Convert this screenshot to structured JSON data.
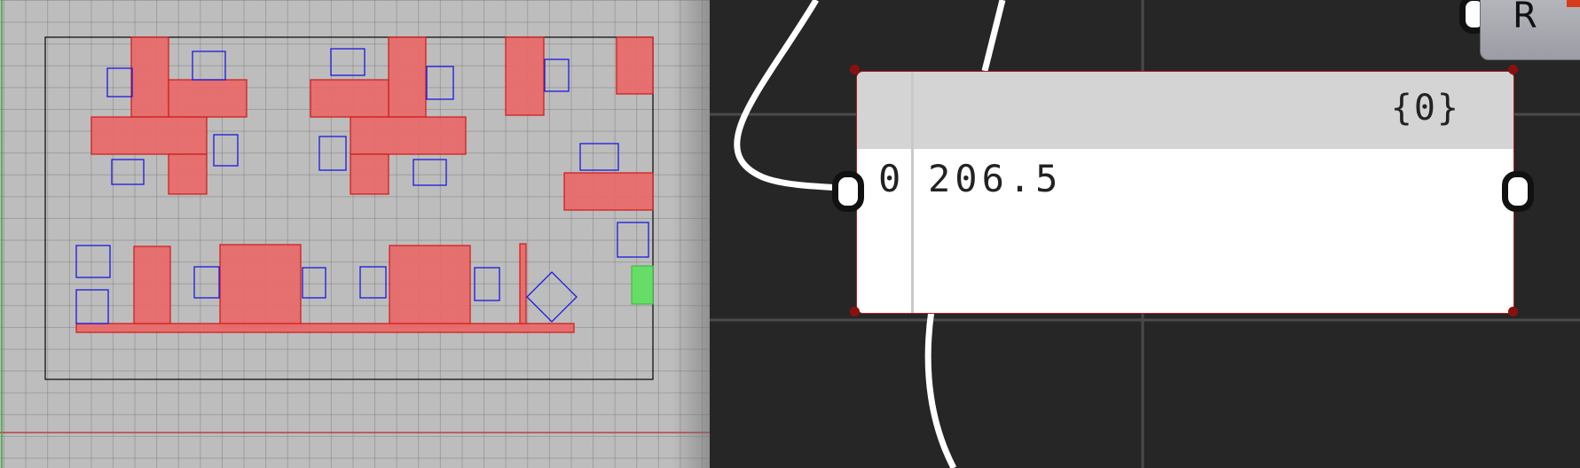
{
  "viewport": {
    "name": "rhino-viewport",
    "colors": {
      "background": "#bdbdbd",
      "boundary": "#111111",
      "furniture_fill": "#e86a6a",
      "furniture_stroke": "#d01818",
      "openings": "#1a1ae0",
      "selected": "#66dd66",
      "x_axis": "#b94040",
      "y_axis": "#3fa63f"
    }
  },
  "panel": {
    "path": "{0}",
    "rows": [
      {
        "index": "0",
        "value": "206.5"
      }
    ]
  },
  "node": {
    "label": "R"
  },
  "canvas": {
    "background": "#262626",
    "wire_color": "#ffffff",
    "grid_color": "#4a4a4a"
  }
}
